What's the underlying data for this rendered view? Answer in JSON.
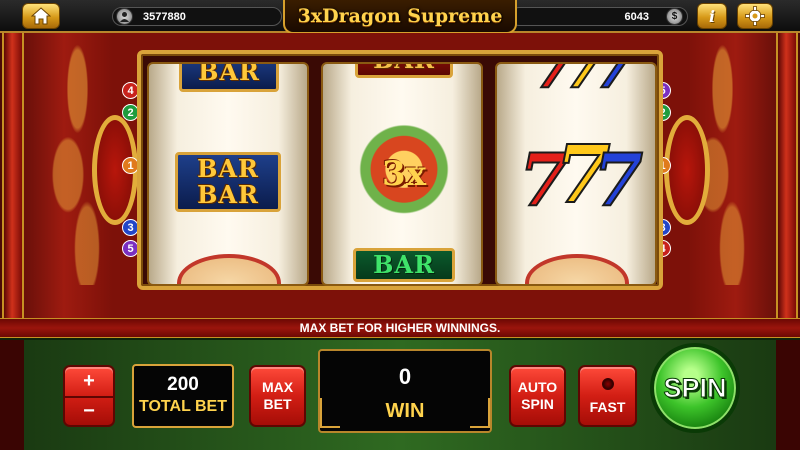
{
  "header": {
    "home_icon": "home-icon",
    "balance": "3577880",
    "balance_icon": "user-coin-icon",
    "game_title": "3xDragon Supreme",
    "coins": "6043",
    "coins_icon": "dollar-coin-icon",
    "info_label": "i",
    "settings_icon": "gear-icon"
  },
  "reels": [
    {
      "symbols": [
        "BAR",
        "BAR BAR"
      ]
    },
    {
      "symbols": [
        "BAR",
        "3x",
        "BAR"
      ]
    },
    {
      "symbols": [
        "777",
        "777"
      ]
    }
  ],
  "paylines": {
    "left": [
      "4",
      "2",
      "1",
      "3",
      "5"
    ],
    "right": [
      "5",
      "2",
      "1",
      "3",
      "4"
    ]
  },
  "message": "MAX BET FOR HIGHER WINNINGS.",
  "controls": {
    "plus_label": "+",
    "minus_label": "−",
    "total_bet_value": "200",
    "total_bet_label": "TOTAL BET",
    "max_bet_line1": "MAX",
    "max_bet_line2": "BET",
    "win_value": "0",
    "win_label": "WIN",
    "auto_spin_line1": "AUTO",
    "auto_spin_line2": "SPIN",
    "fast_label": "FAST",
    "spin_label": "SPIN"
  },
  "colors": {
    "cabinet_red": "#7d1109",
    "gold_trim": "#d9a33a",
    "panel_green": "#2f6a21",
    "button_red": "#d21e14",
    "spin_green": "#3dc42a"
  }
}
